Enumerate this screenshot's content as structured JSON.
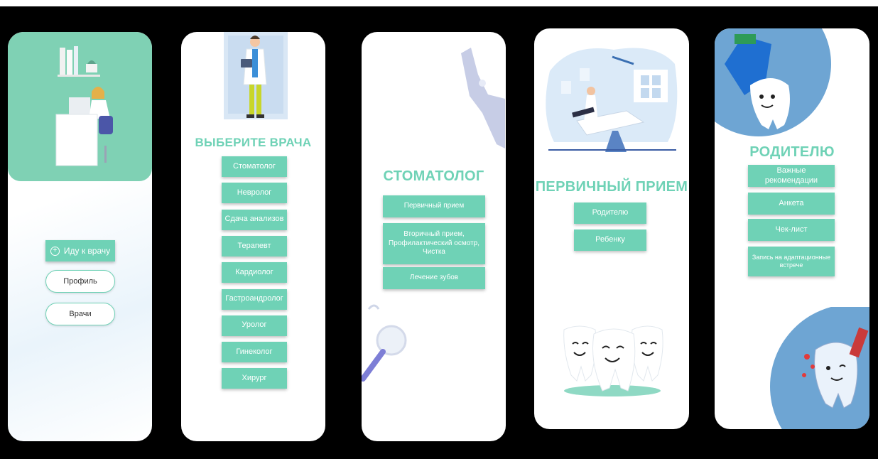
{
  "colors": {
    "accent": "#6fd2b6",
    "header_bg": "#7fd1b4",
    "blue": "#6ea5d3",
    "background": "#000000"
  },
  "screen1": {
    "go_button": {
      "icon": "plus-circle-icon",
      "label": "Иду к врачу"
    },
    "profile_label": "Профиль",
    "doctors_label": "Врачи"
  },
  "screen2": {
    "title": "ВЫБЕРИТЕ ВРАЧА",
    "doctors": [
      "Стоматолог",
      "Невролог",
      "Сдача анализов",
      "Терапевт",
      "Кардиолог",
      "Гастроандролог",
      "Уролог",
      "Гинеколог",
      "Хирург"
    ]
  },
  "screen3": {
    "title": "СТОМАТОЛОГ",
    "items": [
      "Первичный прием",
      "Вторичный прием, Профилактический осмотр, Чистка",
      "Лечение зубов"
    ]
  },
  "screen4": {
    "title": "ПЕРВИЧНЫЙ ПРИЕМ",
    "items": [
      "Родителю",
      "Ребенку"
    ]
  },
  "screen5": {
    "title": "РОДИТЕЛЮ",
    "items": [
      "Важные рекомендации",
      "Анкета",
      "Чек-лист",
      "Запись на адаптационные встрече"
    ]
  }
}
